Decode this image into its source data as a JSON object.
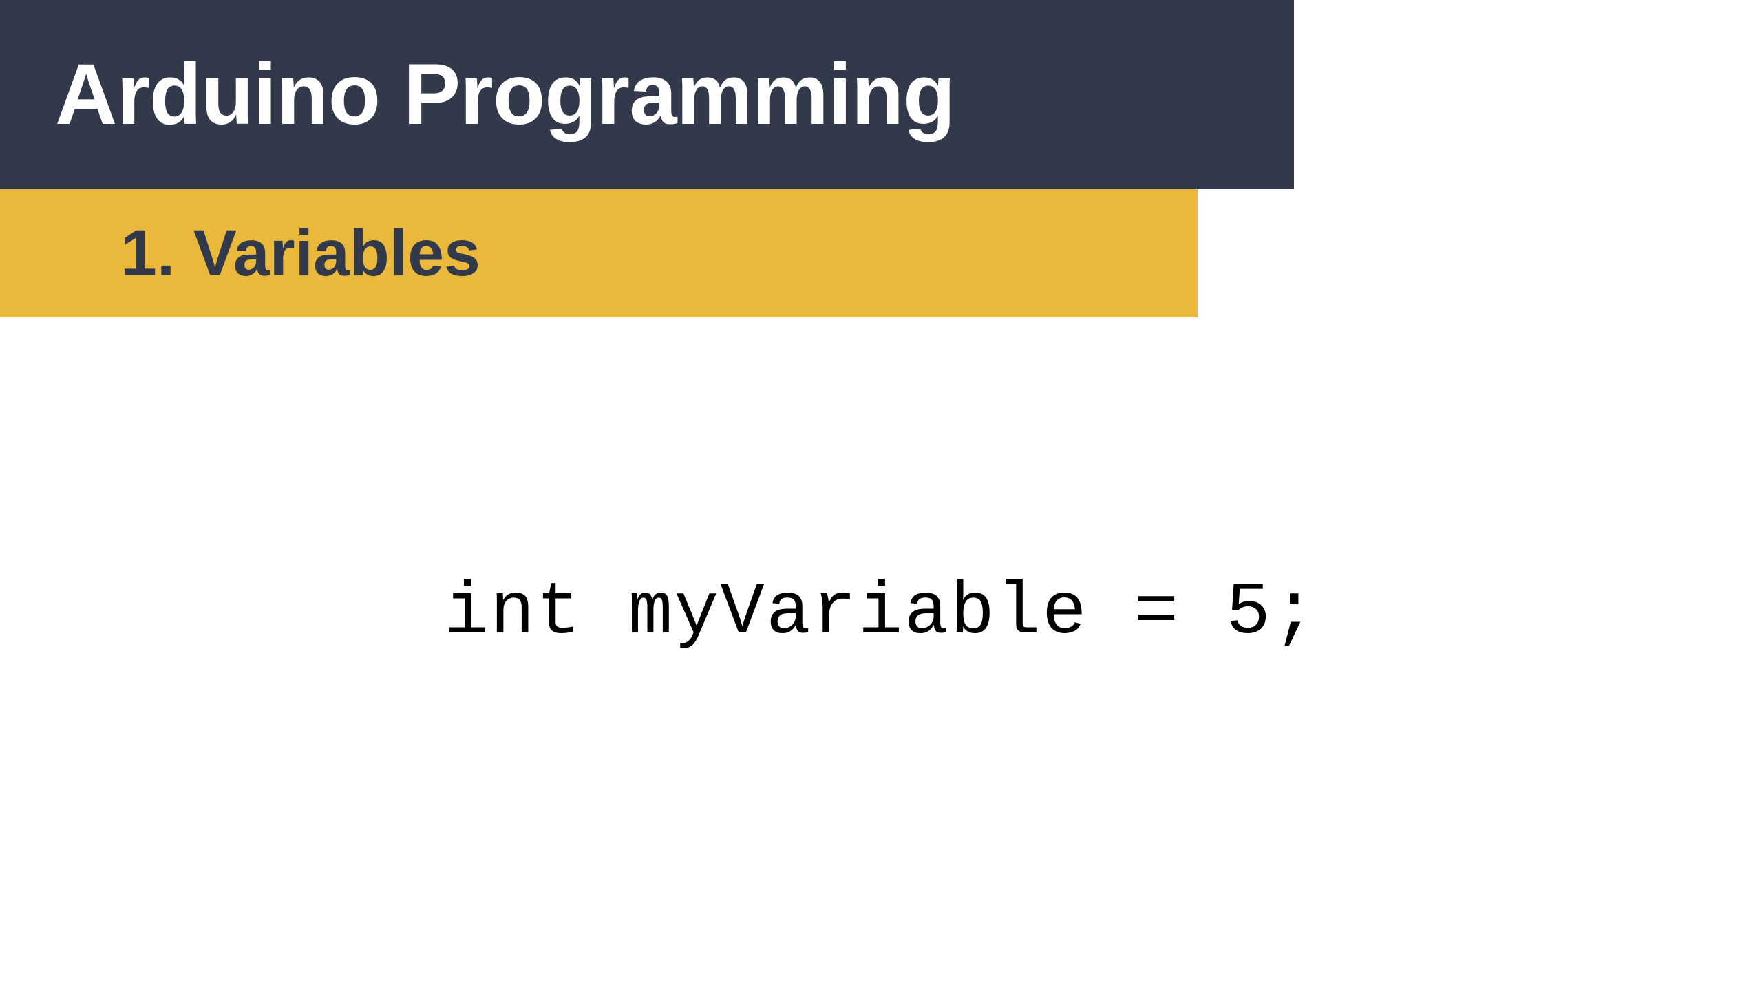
{
  "header": {
    "title": "Arduino Programming"
  },
  "subheader": {
    "text": "1.  Variables"
  },
  "code": {
    "content": "int myVariable = 5;"
  }
}
